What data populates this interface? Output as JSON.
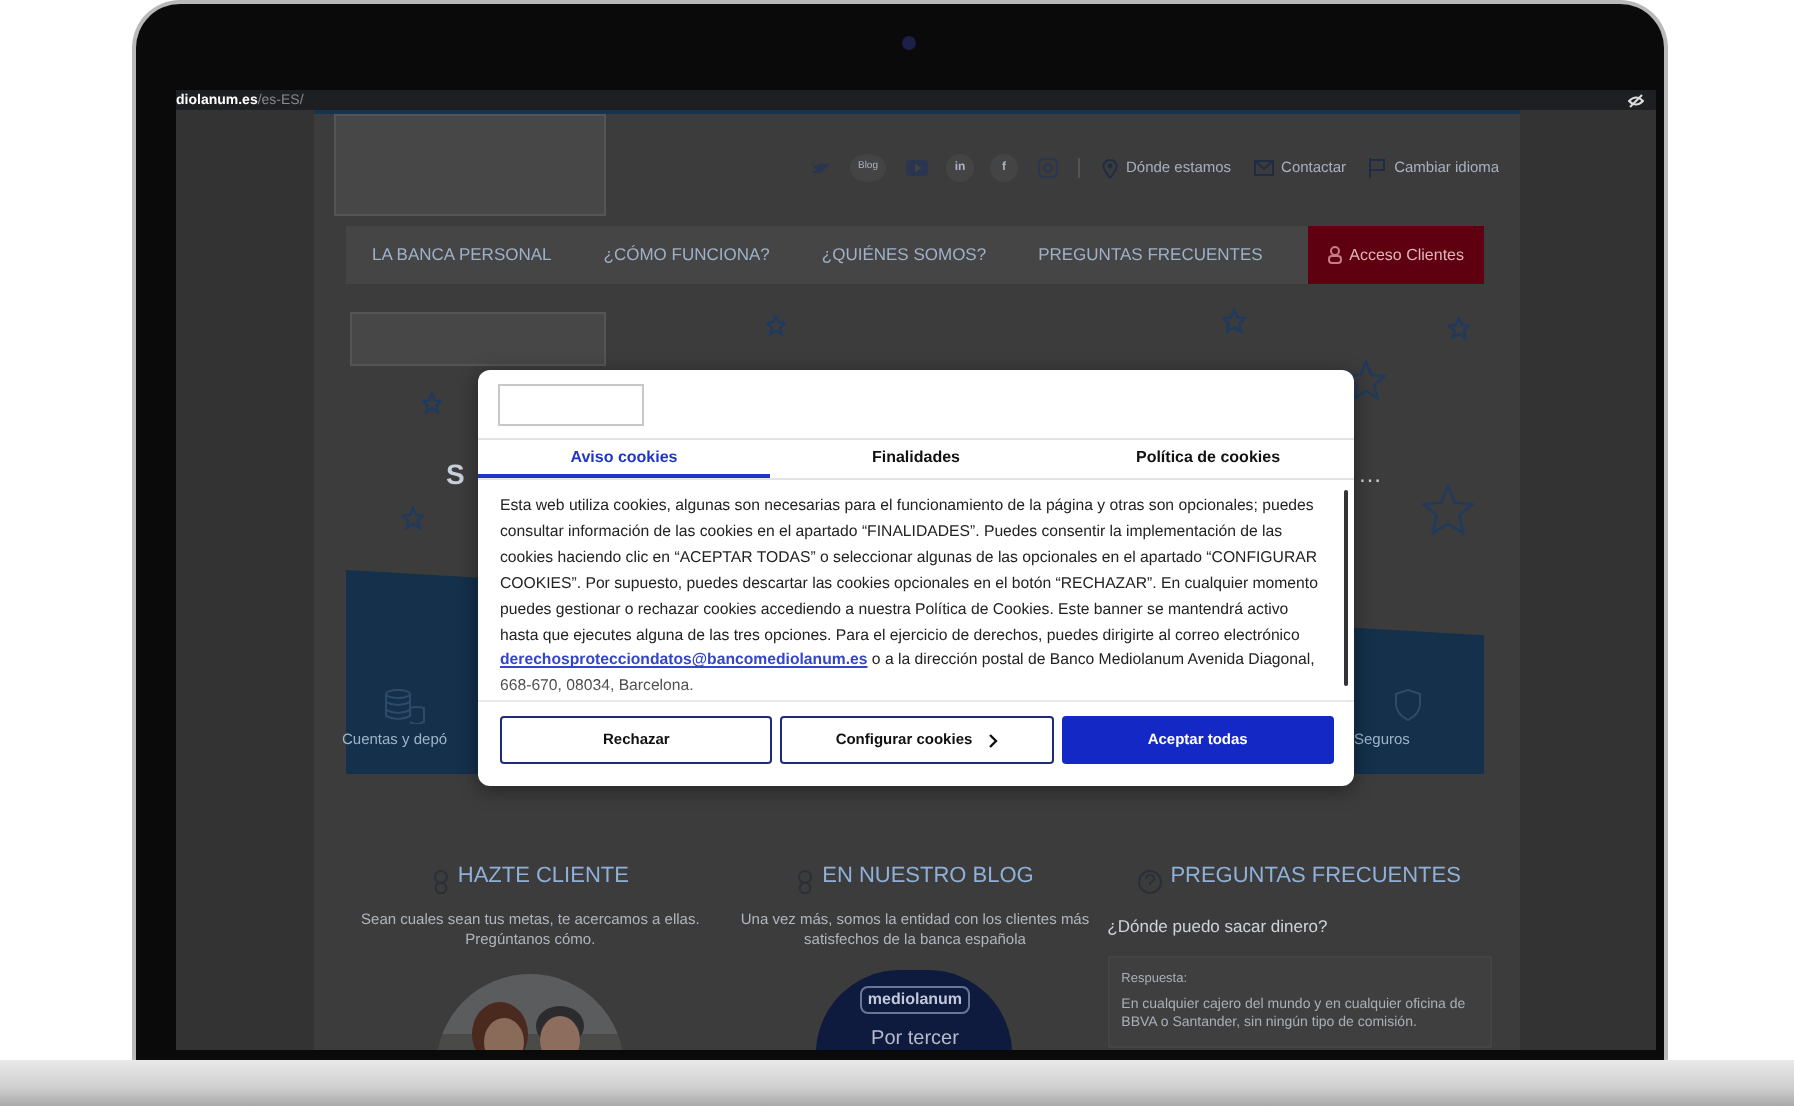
{
  "browser": {
    "url_host": "diolanum.es",
    "url_path": "/es-ES/"
  },
  "header": {
    "social": [
      {
        "kind": "bird"
      },
      {
        "kind": "blog",
        "label": "Blog"
      },
      {
        "kind": "play"
      },
      {
        "kind": "letters",
        "label": "in"
      },
      {
        "kind": "letters",
        "label": "f"
      },
      {
        "kind": "camera"
      }
    ],
    "links": [
      {
        "kind": "pin",
        "label": "Dónde estamos"
      },
      {
        "kind": "mail",
        "label": "Contactar"
      },
      {
        "kind": "flag",
        "label": "Cambiar idioma"
      }
    ]
  },
  "nav": {
    "items": [
      "LA BANCA PERSONAL",
      "¿CÓMO FUNCIONA?",
      "¿QUIÉNES SOMOS?",
      "PREGUNTAS FRECUENTES"
    ],
    "login": "Acceso Clientes"
  },
  "hero": {
    "heading_start": "S",
    "heading_end": "…",
    "products": [
      {
        "kind": "coins",
        "label": "Cuentas y depó"
      },
      {
        "kind": "shield",
        "label": "Seguros"
      }
    ]
  },
  "cookie_banner": {
    "tabs": [
      {
        "label": "Aviso cookies",
        "selected": true
      },
      {
        "label": "Finalidades",
        "selected": false
      },
      {
        "label": "Política de cookies",
        "selected": false
      }
    ],
    "text_before": "Esta web utiliza cookies, algunas son necesarias para el funcionamiento de la página y otras son opcionales; puedes consultar información de las cookies en el apartado “FINALIDADES”. Puedes consentir la implementación de las cookies haciendo clic en “ACEPTAR TODAS” o seleccionar algunas de las opcionales en el apartado “CONFIGURAR COOKIES”. Por supuesto, puedes descartar las cookies opcionales en el botón “RECHAZAR”. En cualquier momento puedes gestionar o rechazar cookies accediendo a nuestra Política de Cookies. Este banner se mantendrá activo hasta que ejecutes alguna de las tres opciones. Para el ejercicio de derechos, puedes dirigirte al correo electrónico",
    "email": "derechosprotecciondatos@bancomediolanum.es",
    "text_after": "o a la dirección postal de Banco Mediolanum Avenida Diagonal, 668-670, 08034, Barcelona.",
    "buttons": [
      {
        "kind": "outline",
        "label": "Rechazar"
      },
      {
        "kind": "next",
        "label": "Configurar cookies"
      },
      {
        "kind": "primary",
        "label": "Aceptar todas"
      }
    ]
  },
  "sections": [
    {
      "kind": "join",
      "title": "HAZTE CLIENTE",
      "text": "Sean cuales sean tus metas, te acercamos a ellas. Pregúntanos cómo."
    },
    {
      "kind": "blog",
      "title": "EN NUESTRO BLOG",
      "text": "Una vez más, somos la entidad con los clientes más satisfechos de la banca española",
      "brand": "mediolanum",
      "headline": "Por tercer"
    },
    {
      "kind": "faq",
      "title": "PREGUNTAS FRECUENTES",
      "question": "¿Dónde puedo sacar dinero?",
      "answer_label": "Respuesta:",
      "answer": "En cualquier cajero del mundo y en cualquier oficina de BBVA o Santander, sin ningún tipo de comisión."
    }
  ]
}
